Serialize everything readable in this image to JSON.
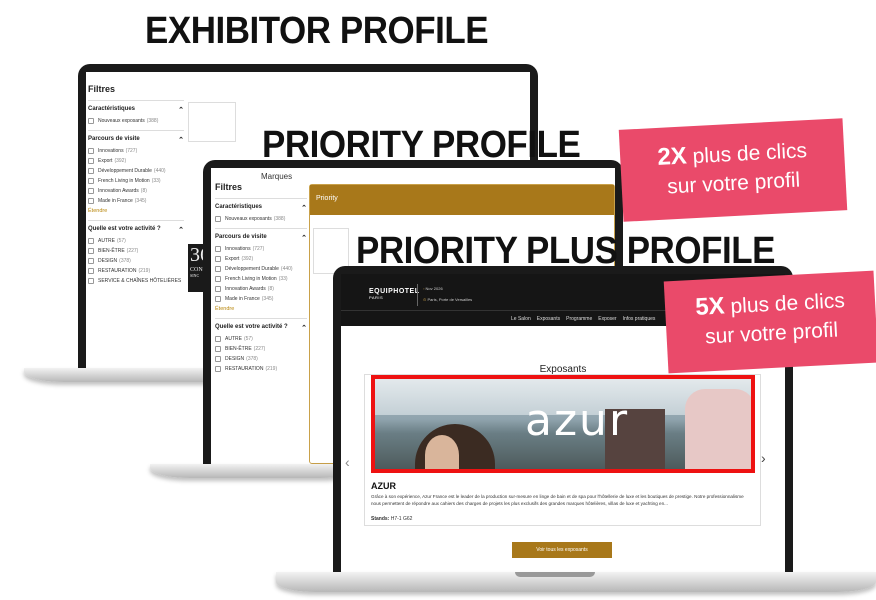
{
  "headlines": {
    "exhibitor": "EXHIBITOR PROFILE",
    "priority": "PRIORITY PROFILE",
    "priority_plus": "PRIORITY PLUS PROFILE"
  },
  "badges": {
    "priority": {
      "big": "2X",
      "rest": " plus de clics",
      "line2": "sur votre profil"
    },
    "priority_plus": {
      "big": "5X",
      "rest": " plus de clics",
      "line2": "sur votre profil"
    }
  },
  "filters": {
    "title": "Filtres",
    "characteristics": {
      "label": "Caractéristiques",
      "items": [
        {
          "label": "Nouveaux exposants",
          "count": "(388)"
        }
      ]
    },
    "parcours": {
      "label": "Parcours de visite",
      "items": [
        {
          "label": "Innovations",
          "count": "(727)"
        },
        {
          "label": "Export",
          "count": "(392)"
        },
        {
          "label": "Développement Durable",
          "count": "(440)"
        },
        {
          "label": "French Living in Motion",
          "count": "(33)"
        },
        {
          "label": "Innovation Awards",
          "count": "(8)"
        },
        {
          "label": "Made in France",
          "count": "(345)"
        }
      ],
      "more": "Étendre"
    },
    "activity": {
      "label": "Quelle est votre activité ?",
      "items": [
        {
          "label": "AUTRE",
          "count": "(57)"
        },
        {
          "label": "BIEN-ÊTRE",
          "count": "(227)"
        },
        {
          "label": "DESIGN",
          "count": "(378)"
        },
        {
          "label": "RESTAURATION",
          "count": "(219)"
        },
        {
          "label": "SERVICE & CHAÎNES HÔTELIÈRES",
          "count": ""
        }
      ]
    }
  },
  "priority_screen": {
    "marques": "Marques",
    "priority_label": "Priority",
    "brand_letters": "36",
    "brand_sub1": "CON",
    "brand_sub2": "SINC"
  },
  "plus_screen": {
    "logo": "EQUIPHOTEL",
    "logo_sub": "PARIS",
    "date": "Nov 2026",
    "location": "Paris, Porte de Versailles",
    "menu": [
      "Le Salon",
      "Exposants",
      "Programme",
      "Exposer",
      "Infos pratiques"
    ],
    "section_title": "Exposants",
    "hero_brand": "azur",
    "exhibitor_name": "AZUR",
    "description": "Grâce à son expérience, Azur France est le leader de la production sur-mesure en linge de bain et de spa pour l'hôtellerie de luxe et les boutiques de prestige. Notre professionnalisme nous permettent de répondre aux cahiers des charges de projets les plus exclusifs des grandes marques hôtelières, villas de luxe et yachting en...",
    "stands_label": "Stands:",
    "stands_value": "H7-1 G62",
    "cta": "Voir tous les exposants",
    "prev": "‹",
    "next": "›"
  },
  "colors": {
    "badge": "#ea4a6a",
    "gold": "#a8781a",
    "highlight_red": "#e11",
    "dark_nav": "#151515"
  }
}
